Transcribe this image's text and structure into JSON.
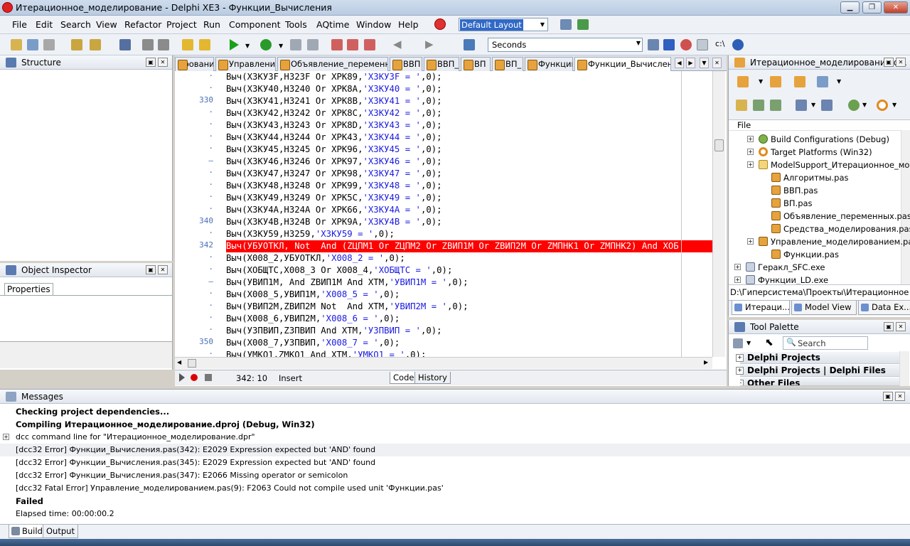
{
  "window": {
    "title": "Итерационное_моделирование - Delphi XE3 - Функции_Вычисления",
    "minimize": "▁",
    "maximize": "❐",
    "close": "✕"
  },
  "menu": {
    "items": [
      "File",
      "Edit",
      "Search",
      "View",
      "Refactor",
      "Project",
      "Run",
      "Component",
      "Tools",
      "AQtime",
      "Window",
      "Help"
    ],
    "layout_value": "Default Layout"
  },
  "toolbar": {
    "seconds_value": "Seconds",
    "c_label": "c:\\"
  },
  "structure": {
    "title": "Structure"
  },
  "object_inspector": {
    "title": "Object Inspector",
    "tab": "Properties"
  },
  "editor": {
    "tabs": [
      "ировани­ем",
      "Управление",
      "Объявление_переменных",
      "ВВП",
      "ВВП_",
      "ВП",
      "ВП_",
      "Функции",
      "Функции_Вычисления"
    ],
    "gutter": [
      {
        "row": 0,
        "text": "·"
      },
      {
        "row": 1,
        "text": "·"
      },
      {
        "row": 2,
        "text": "330"
      },
      {
        "row": 3,
        "text": "·"
      },
      {
        "row": 4,
        "text": "·"
      },
      {
        "row": 5,
        "text": "·"
      },
      {
        "row": 6,
        "text": "·"
      },
      {
        "row": 7,
        "text": "–"
      },
      {
        "row": 8,
        "text": "·"
      },
      {
        "row": 9,
        "text": "·"
      },
      {
        "row": 10,
        "text": "·"
      },
      {
        "row": 11,
        "text": "·"
      },
      {
        "row": 12,
        "text": "340"
      },
      {
        "row": 13,
        "text": "·"
      },
      {
        "row": 14,
        "text": "342"
      },
      {
        "row": 15,
        "text": "·"
      },
      {
        "row": 16,
        "text": "·"
      },
      {
        "row": 17,
        "text": "–"
      },
      {
        "row": 18,
        "text": "·"
      },
      {
        "row": 19,
        "text": "·"
      },
      {
        "row": 20,
        "text": "·"
      },
      {
        "row": 21,
        "text": "·"
      },
      {
        "row": 22,
        "text": "350"
      },
      {
        "row": 23,
        "text": "·"
      }
    ],
    "lines": [
      {
        "pre": "Выч(X3КУ3F,H323F Or XPK89,",
        "str": "'X3КУ3F = '",
        "post": ",0);"
      },
      {
        "pre": "Выч(X3КУ40,H3240 Or XPK8A,",
        "str": "'X3КУ40 = '",
        "post": ",0);"
      },
      {
        "pre": "Выч(X3КУ41,H3241 Or XPK8B,",
        "str": "'X3КУ41 = '",
        "post": ",0);"
      },
      {
        "pre": "Выч(X3КУ42,H3242 Or XPK8C,",
        "str": "'X3КУ42 = '",
        "post": ",0);"
      },
      {
        "pre": "Выч(X3КУ43,H3243 Or XPK8D,",
        "str": "'X3КУ43 = '",
        "post": ",0);"
      },
      {
        "pre": "Выч(X3КУ44,H3244 Or XPK43,",
        "str": "'X3КУ44 = '",
        "post": ",0);"
      },
      {
        "pre": "Выч(X3КУ45,H3245 Or XPK96,",
        "str": "'X3КУ45 = '",
        "post": ",0);"
      },
      {
        "pre": "Выч(X3КУ46,H3246 Or XPK97,",
        "str": "'X3КУ46 = '",
        "post": ",0);"
      },
      {
        "pre": "Выч(X3КУ47,H3247 Or XPK98,",
        "str": "'X3КУ47 = '",
        "post": ",0);"
      },
      {
        "pre": "Выч(X3КУ48,H3248 Or XPK99,",
        "str": "'X3КУ48 = '",
        "post": ",0);"
      },
      {
        "pre": "Выч(X3КУ49,H3249 Or XPK5C,",
        "str": "'X3КУ49 = '",
        "post": ",0);"
      },
      {
        "pre": "Выч(X3КУ4A,H324A Or XPK66,",
        "str": "'X3КУ4A = '",
        "post": ",0);"
      },
      {
        "pre": "Выч(X3КУ4B,H324B Or XPK9A,",
        "str": "'X3КУ4B = '",
        "post": ",0);"
      },
      {
        "pre": "Выч(X3КУ59,H3259,",
        "str": "'X3КУ59 = '",
        "post": ",0);"
      },
      {
        "pre": "Выч(УБУОТКЛ, Not  And (ZЦПМ1 Or ZЦПМ2 Or ZВИП1М Or ZВИП2М Or ZМПНК1 Or ZМПНК2) And XОБ",
        "str": "",
        "post": "",
        "error": true
      },
      {
        "pre": "Выч(X008_2,УБУОТКЛ,",
        "str": "'X008_2 = '",
        "post": ",0);"
      },
      {
        "pre": "Выч(XОБЩТС,X008_3 Or X008_4,",
        "str": "'XОБЩТС = '",
        "post": ",0);"
      },
      {
        "pre": "Выч(УВИП1М, And ZВИП1М And XТМ,",
        "str": "'УВИП1М = '",
        "post": ",0);"
      },
      {
        "pre": "Выч(X008_5,УВИП1М,",
        "str": "'X008_5 = '",
        "post": ",0);"
      },
      {
        "pre": "Выч(УВИП2М,ZВИП2М Not  And XТМ,",
        "str": "'УВИП2М = '",
        "post": ",0);"
      },
      {
        "pre": "Выч(X008_6,УВИП2М,",
        "str": "'X008_6 = '",
        "post": ",0);"
      },
      {
        "pre": "Выч(УЗПВИП,ZЗПВИП And XТМ,",
        "str": "'УЗПВИП = '",
        "post": ",0);"
      },
      {
        "pre": "Выч(X008_7,УЗПВИП,",
        "str": "'X008_7 = '",
        "post": ",0);"
      },
      {
        "pre": "Выч(УМКО1,ZМКО1 And XТМ,",
        "str": "'УМКО1 = '",
        "post": ",0);"
      }
    ],
    "status_pos": "342:  10",
    "status_mode": "Insert",
    "bottom_tabs": [
      "Code",
      "History"
    ]
  },
  "project": {
    "title": "Итерационное_моделирование.d...",
    "column": "File",
    "tree": [
      {
        "label": "Build Configurations (Debug)",
        "icon": "cfg",
        "exp": "+"
      },
      {
        "label": "Target Platforms (Win32)",
        "icon": "tgt",
        "exp": "+"
      },
      {
        "label": "ModelSupport_Итерационное_мо...",
        "icon": "folder",
        "exp": "+"
      },
      {
        "label": "Алгоритмы.pas",
        "icon": "pas",
        "exp": ""
      },
      {
        "label": "ВВП.pas",
        "icon": "pas",
        "exp": ""
      },
      {
        "label": "ВП.pas",
        "icon": "pas",
        "exp": ""
      },
      {
        "label": "Объявление_переменных.pas",
        "icon": "pas",
        "exp": ""
      },
      {
        "label": "Средства_моделирования.pas",
        "icon": "pas",
        "exp": ""
      },
      {
        "label": "Управление_моделированием.pas",
        "icon": "pas",
        "exp": "+"
      },
      {
        "label": "Функции.pas",
        "icon": "pas",
        "exp": ""
      },
      {
        "label": "Геракл_SFC.exe",
        "icon": "exe",
        "exp": "+"
      },
      {
        "label": "Функции_LD.exe",
        "icon": "exe",
        "exp": "+"
      }
    ],
    "path": "D:\\Гиперсистема\\Проекты\\Итерационное моделир",
    "tabs": [
      "Итераци...",
      "Model View",
      "Data Ex..."
    ]
  },
  "palette": {
    "title": "Tool Palette",
    "search_placeholder": "Search",
    "categories": [
      "Delphi Projects",
      "Delphi Projects | Delphi Files",
      "Other Files"
    ]
  },
  "messages": {
    "title": "Messages",
    "lines": [
      {
        "text": "Checking project dependencies...",
        "bold": true
      },
      {
        "text": "Compiling Итерационное_моделирование.dproj (Debug, Win32)",
        "bold": true
      },
      {
        "text": "dcc command line for \"Итерационное_моделирование.dpr\"",
        "bold": false
      },
      {
        "text": "[dcc32 Error] Функции_Вычисления.pas(342): E2029 Expression expected but 'AND' found",
        "bold": false
      },
      {
        "text": "[dcc32 Error] Функции_Вычисления.pas(345): E2029 Expression expected but 'AND' found",
        "bold": false
      },
      {
        "text": "[dcc32 Error] Функции_Вычисления.pas(347): E2066 Missing operator or semicolon",
        "bold": false
      },
      {
        "text": "[dcc32 Fatal Error] Управление_моделированием.pas(9): F2063 Could not compile used unit 'Функции.pas'",
        "bold": false
      },
      {
        "text": "Failed",
        "bold": true
      },
      {
        "text": "Elapsed time: 00:00:00.2",
        "bold": false
      }
    ],
    "tabs": [
      "Build",
      "Output"
    ]
  },
  "colors": {
    "error_line": "#ff0000",
    "string_literal": "#1a1ae0",
    "line_number": "#4a6fb6"
  }
}
